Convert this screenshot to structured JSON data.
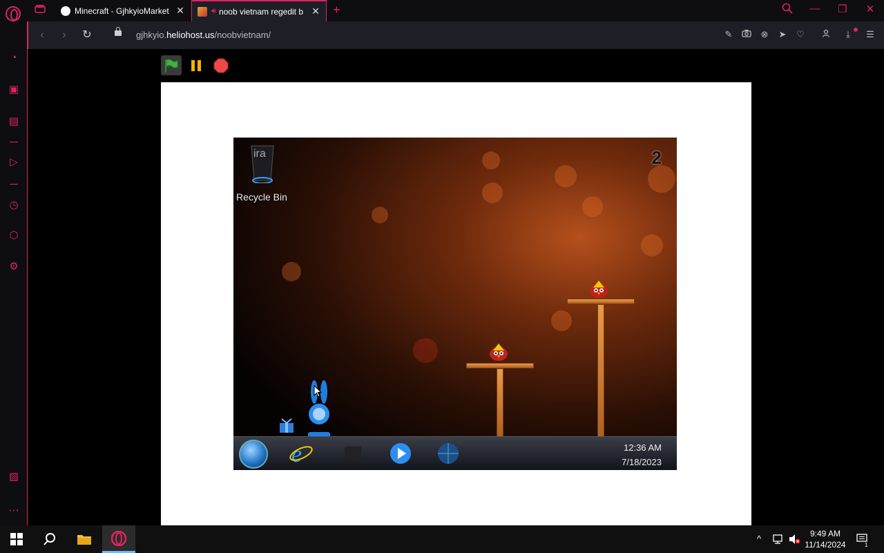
{
  "browser": {
    "tabs": [
      {
        "title": "Minecraft - GjhkyioMarket",
        "active": false
      },
      {
        "title": "noob vietnam regedit b",
        "active": true,
        "audio": true
      }
    ],
    "address": {
      "domain_prefix": "gjhkyio.",
      "domain_main": "heliohost.us",
      "path": "/noobvietnam/"
    },
    "accent_color": "#e0245e"
  },
  "sidebar": {
    "icons": [
      "speed-dial-icon",
      "workspace-icon",
      "wallet-icon",
      "player-icon",
      "history-icon",
      "extensions-icon",
      "settings-icon",
      "pinboard-icon",
      "more-icon"
    ]
  },
  "player_controls": {
    "green_flag": "green-flag-icon",
    "pause": "pause-icon",
    "stop": "stop-icon"
  },
  "game": {
    "score": "2",
    "desktop_icon_label": "Recycle Bin",
    "taskbar_time": "12:36 AM",
    "taskbar_date": "7/18/2023"
  },
  "os": {
    "clock_time": "9:49 AM",
    "clock_date": "11/14/2024",
    "notification_count": "1"
  }
}
